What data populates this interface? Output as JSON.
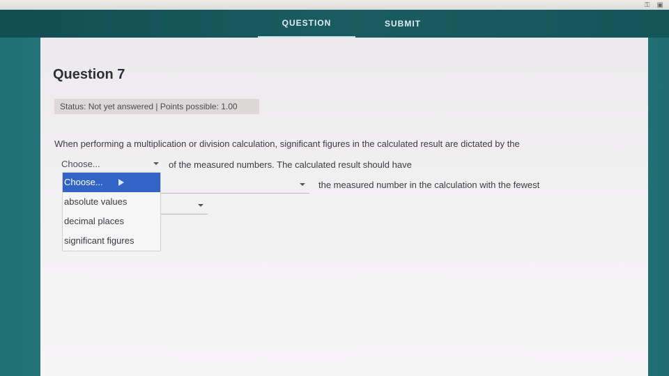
{
  "tabs": [
    {
      "label": "QUESTION",
      "active": true
    },
    {
      "label": "SUBMIT",
      "active": false
    }
  ],
  "question": {
    "title": "Question 7",
    "status": "Status: Not yet answered | Points possible: 1.00",
    "line1": "When performing a multiplication or division calculation, significant figures in the calculated result are dictated by the",
    "line2": "of the measured numbers. The calculated result should have",
    "line3": "the measured number in the calculation with the fewest"
  },
  "selects": {
    "first_value": "Choose...",
    "second_value": "",
    "third_value": ""
  },
  "dropdown": {
    "options": [
      "Choose...",
      "absolute values",
      "decimal places",
      "significant figures"
    ],
    "selected": "Choose..."
  },
  "icons": {
    "browser_ext_1": "key-icon",
    "browser_ext_2": "extension-icon",
    "pointer": "mouse-pointer-icon"
  },
  "colors": {
    "navbar": "#185c61",
    "highlight": "#3264c6",
    "background": "#2a8085"
  }
}
